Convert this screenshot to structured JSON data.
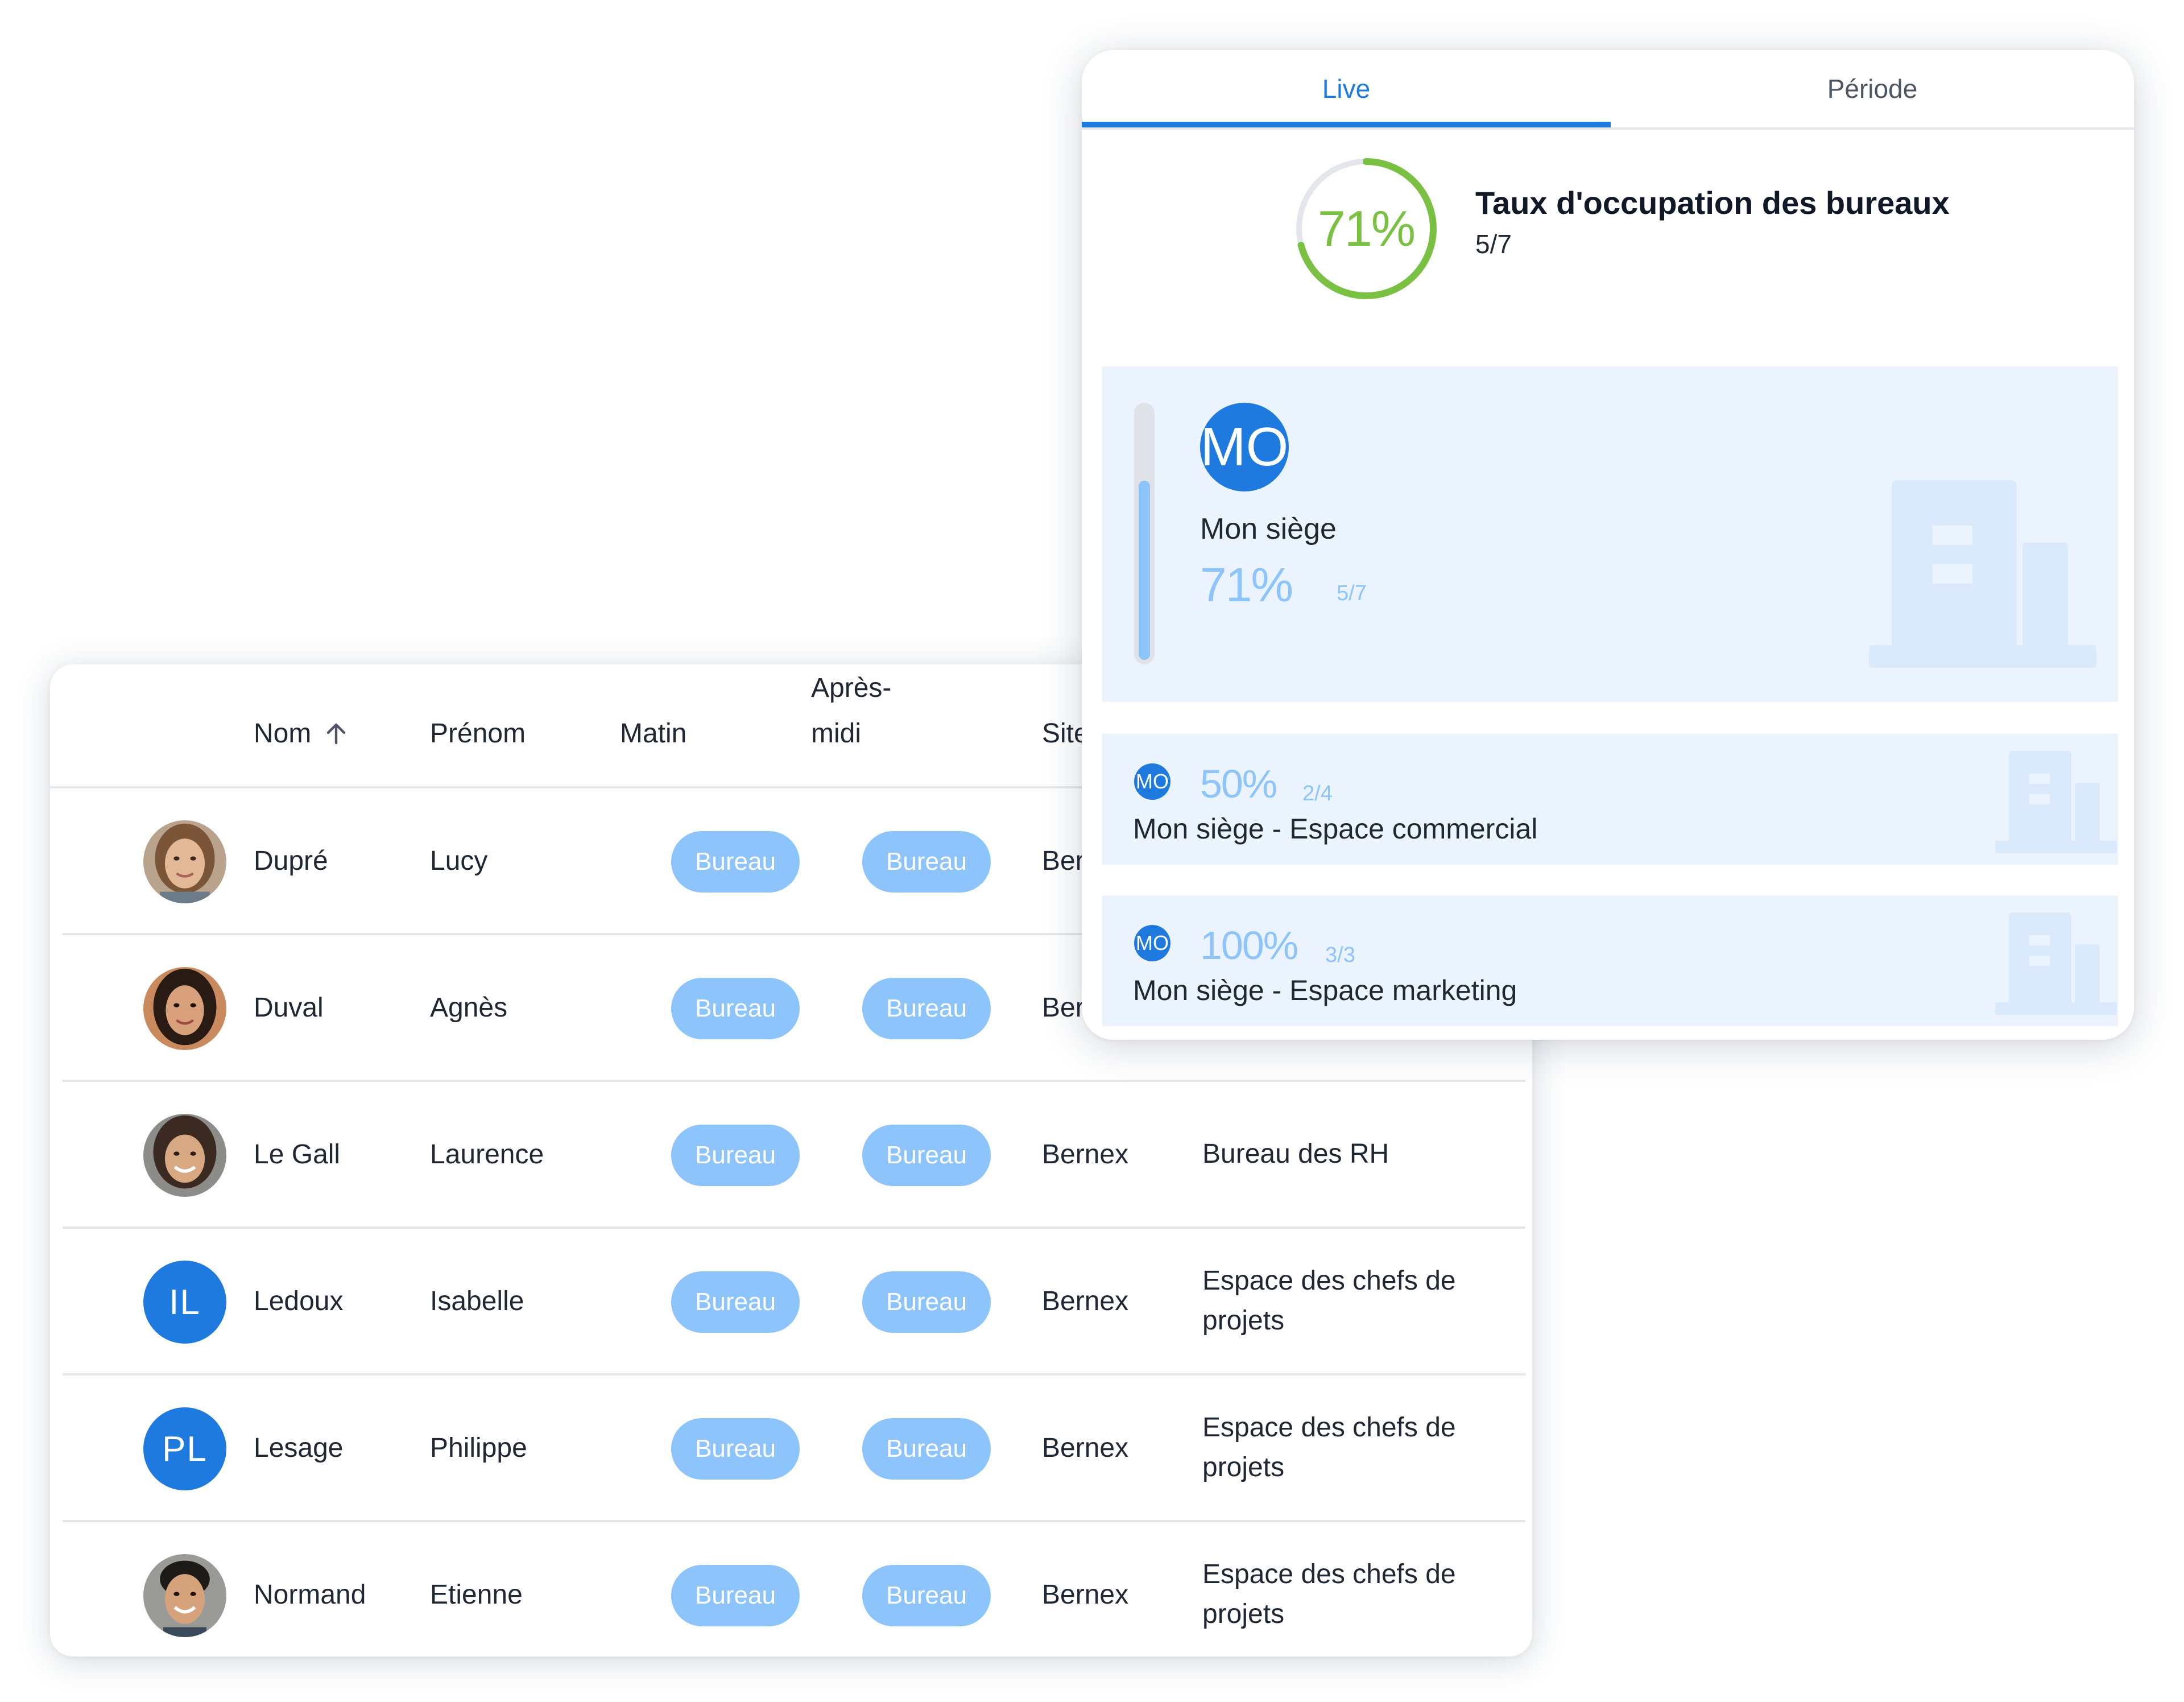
{
  "table": {
    "headers": {
      "nom": "Nom",
      "prenom": "Prénom",
      "matin": "Matin",
      "apres_midi": "Après-midi",
      "site": "Site"
    },
    "rows": [
      {
        "avatar": "photo",
        "initials": "",
        "nom": "Dupré",
        "prenom": "Lucy",
        "matin": "Bureau",
        "apres_midi": "Bureau",
        "site": "Bernex",
        "espace": ""
      },
      {
        "avatar": "photo",
        "initials": "",
        "nom": "Duval",
        "prenom": "Agnès",
        "matin": "Bureau",
        "apres_midi": "Bureau",
        "site": "Bernex",
        "espace": ""
      },
      {
        "avatar": "photo",
        "initials": "",
        "nom": "Le Gall",
        "prenom": "Laurence",
        "matin": "Bureau",
        "apres_midi": "Bureau",
        "site": "Bernex",
        "espace": "Bureau des RH"
      },
      {
        "avatar": "initials",
        "initials": "IL",
        "nom": "Ledoux",
        "prenom": "Isabelle",
        "matin": "Bureau",
        "apres_midi": "Bureau",
        "site": "Bernex",
        "espace": "Espace des chefs de projets"
      },
      {
        "avatar": "initials",
        "initials": "PL",
        "nom": "Lesage",
        "prenom": "Philippe",
        "matin": "Bureau",
        "apres_midi": "Bureau",
        "site": "Bernex",
        "espace": "Espace des chefs de projets"
      },
      {
        "avatar": "photo",
        "initials": "",
        "nom": "Normand",
        "prenom": "Etienne",
        "matin": "Bureau",
        "apres_midi": "Bureau",
        "site": "Bernex",
        "espace": "Espace des chefs de projets"
      }
    ]
  },
  "dashboard": {
    "tabs": [
      {
        "label": "Live",
        "active": true
      },
      {
        "label": "Période",
        "active": false
      }
    ],
    "occupancy": {
      "percent_label": "71%",
      "fraction": 0.71,
      "title": "Taux d'occupation des bureaux",
      "count": "5/7"
    },
    "main_site": {
      "initials": "MO",
      "name": "Mon siège",
      "percent_label": "71%",
      "fraction": 0.71,
      "count": "5/7"
    },
    "sub_sites": [
      {
        "initials": "MO",
        "percent_label": "50%",
        "count": "2/4",
        "name": "Mon siège - Espace commercial"
      },
      {
        "initials": "MO",
        "percent_label": "100%",
        "count": "3/3",
        "name": "Mon siège - Espace marketing"
      }
    ]
  },
  "colors": {
    "accent_blue": "#1f7ae0",
    "pill_blue": "#8cc4fb",
    "gauge_green": "#7ac143",
    "panel_bg": "#ebf4fe"
  }
}
